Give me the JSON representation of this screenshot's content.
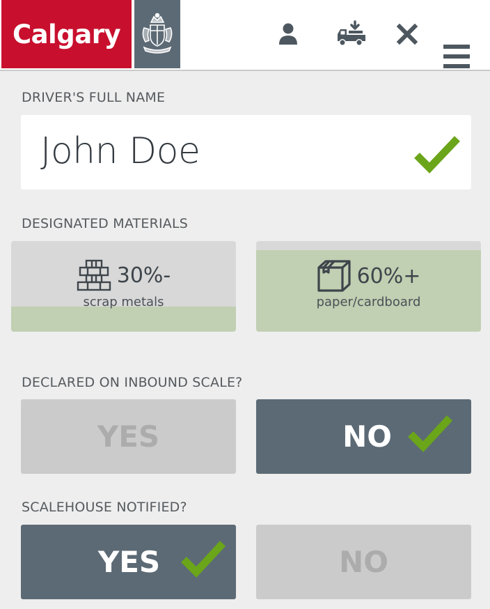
{
  "header": {
    "logo_text": "Calgary",
    "icons": [
      "user-icon",
      "truck-unload-icon",
      "close-icon",
      "menu-icon"
    ]
  },
  "driver": {
    "label": "DRIVER'S FULL NAME",
    "value": "John Doe",
    "valid": true
  },
  "materials": {
    "label": "DESIGNATED MATERIALS",
    "items": [
      {
        "icon": "scrap-metal-icon",
        "percent": "30%-",
        "name": "scrap metals",
        "fill_fraction": 0.28
      },
      {
        "icon": "cardboard-box-icon",
        "percent": "60%+",
        "name": "paper/cardboard",
        "fill_fraction": 0.9
      }
    ]
  },
  "inbound": {
    "label": "DECLARED ON INBOUND SCALE?",
    "yes": "YES",
    "no": "NO",
    "selected": "no"
  },
  "scalehouse": {
    "label": "SCALEHOUSE NOTIFIED?",
    "yes": "YES",
    "no": "NO",
    "selected": "yes"
  },
  "colors": {
    "brand_red": "#c8102e",
    "slate": "#5c6a75",
    "check_green": "#6aa51a",
    "material_green": "#c1cfb2"
  }
}
